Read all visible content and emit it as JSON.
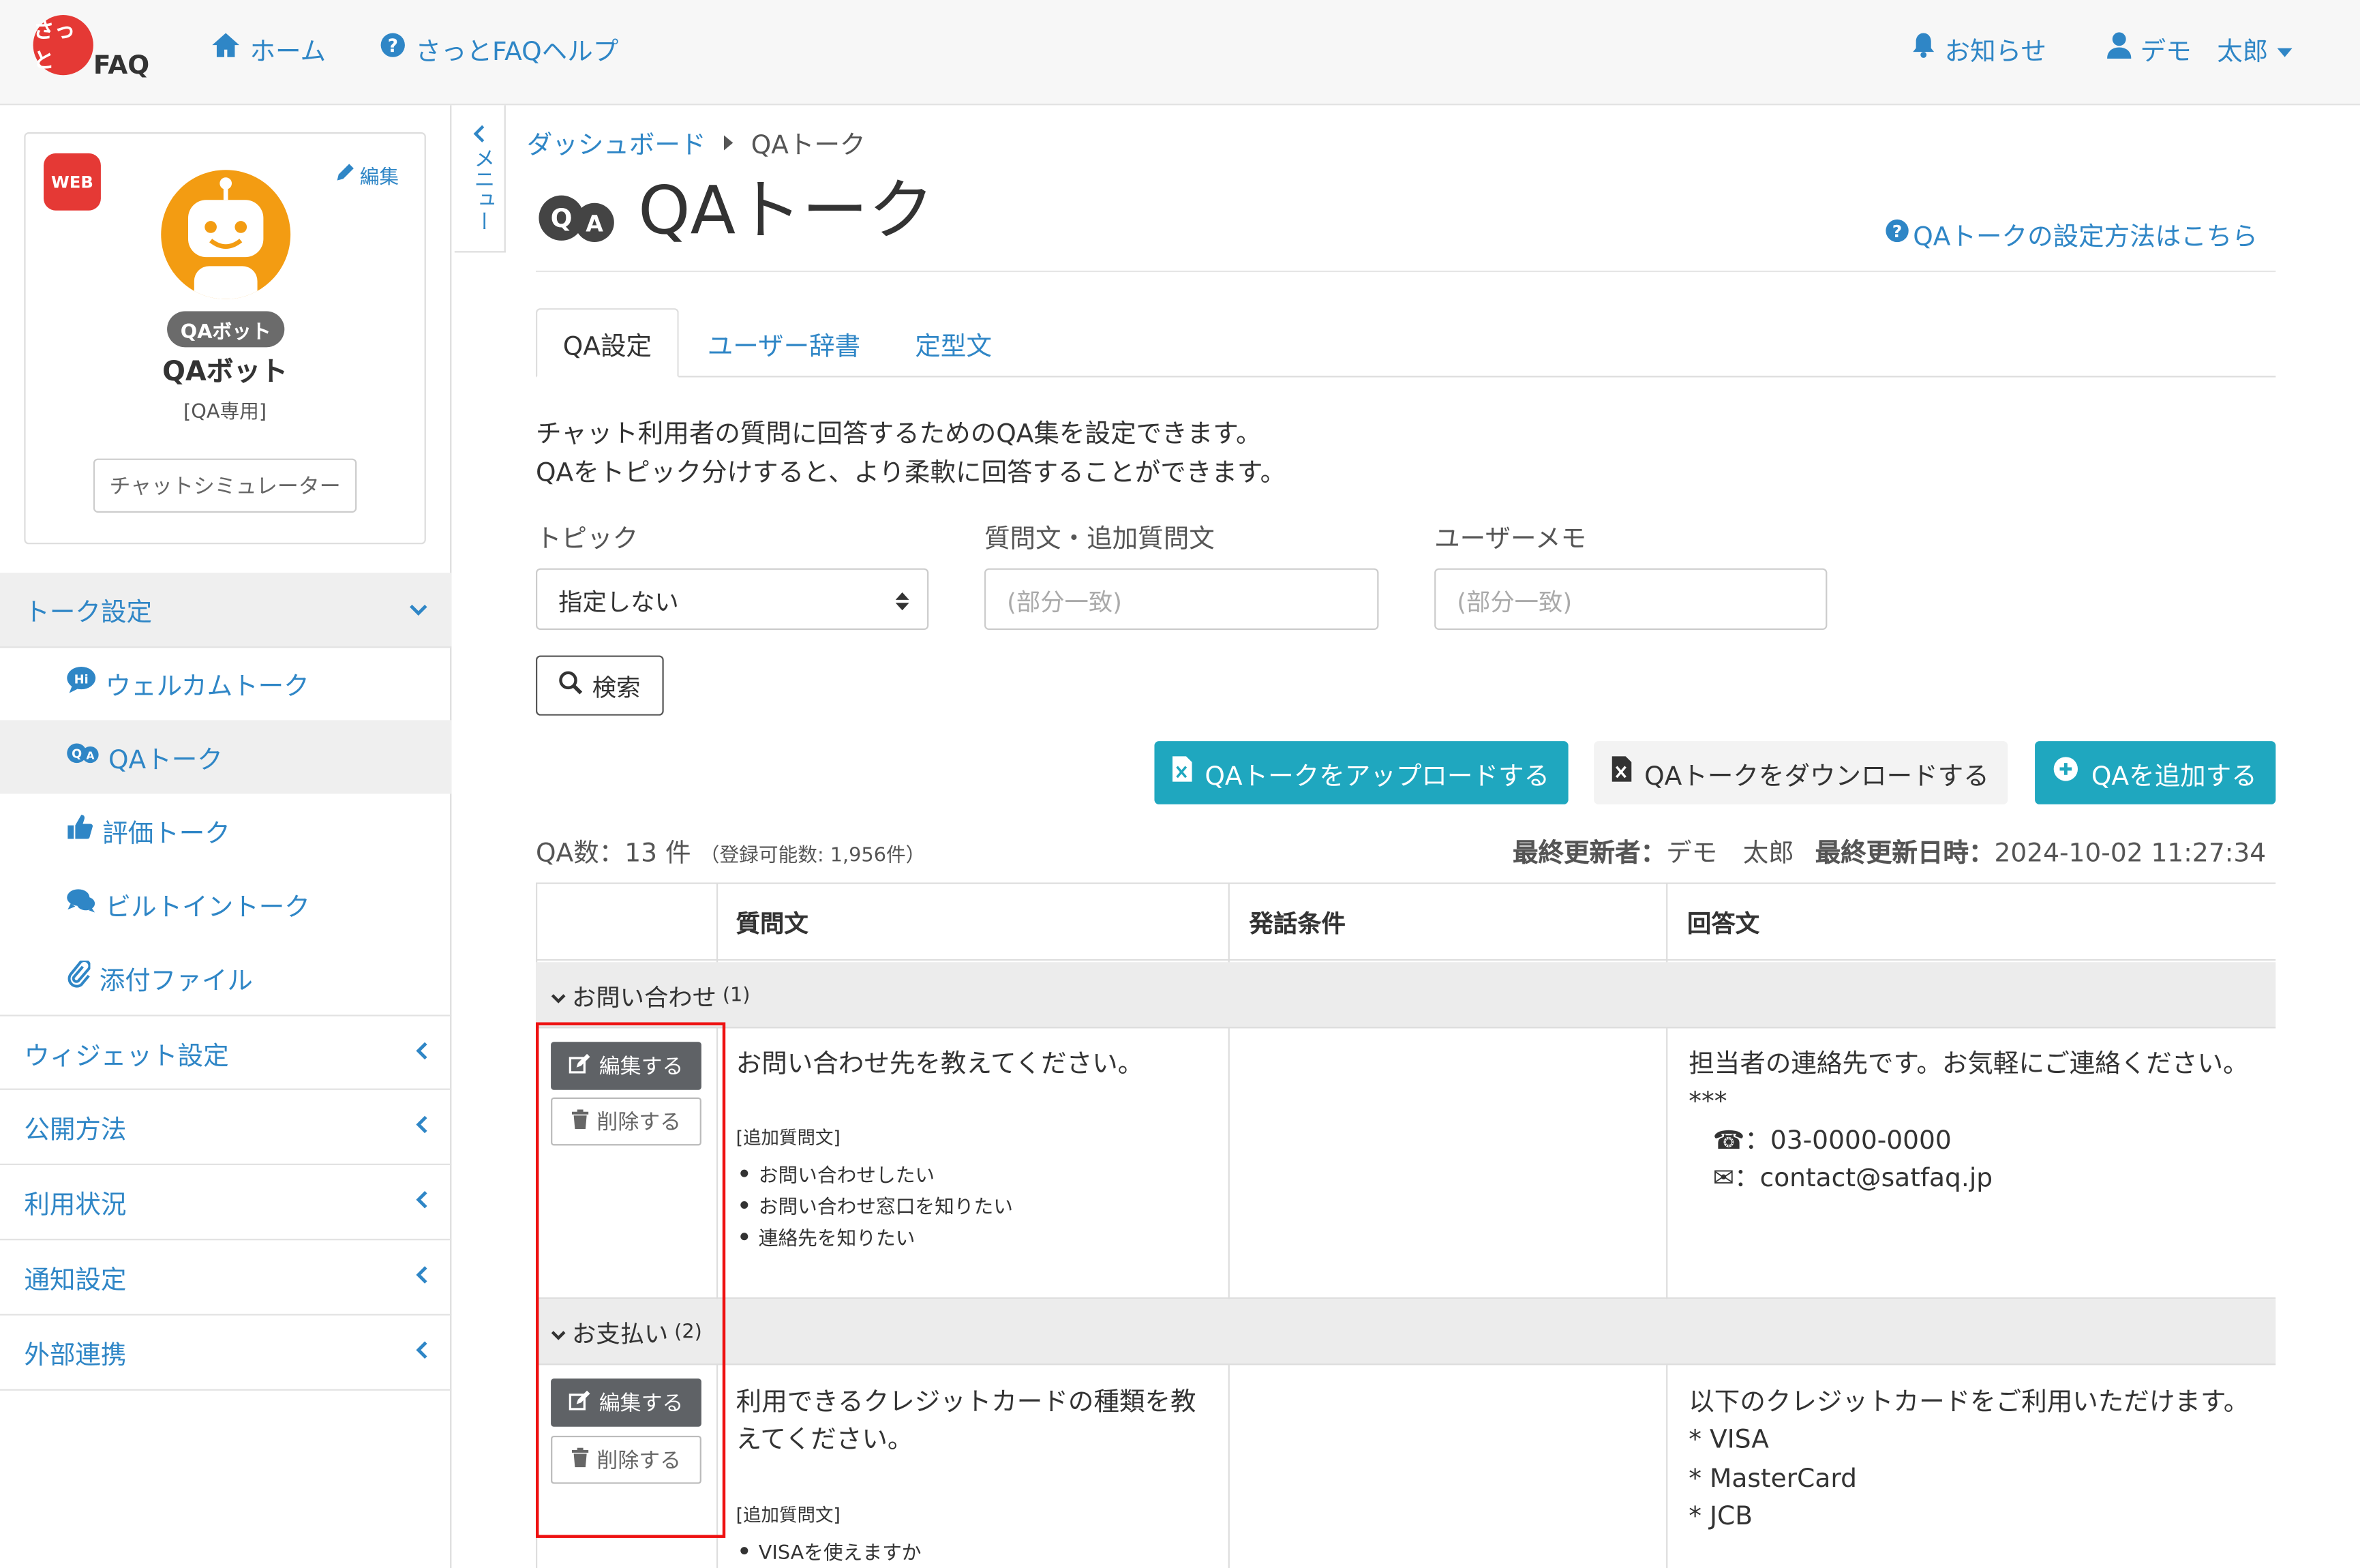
{
  "header": {
    "logo": {
      "mark": "さっと",
      "text": "FAQ"
    },
    "nav_home": "ホーム",
    "nav_help": "さっとFAQヘルプ",
    "notifications": "お知らせ",
    "user_name": "デモ　太郎"
  },
  "sidebar": {
    "badge": "WEB",
    "edit_label": "編集",
    "bot_tag": "QAボット",
    "bot_name": "QAボット",
    "bot_subtitle": "[QA専用]",
    "simulator_button": "チャットシミュレーター",
    "menu_toggle": "メニュー",
    "talk_settings": "トーク設定",
    "sub_items": [
      "ウェルカムトーク",
      "QAトーク",
      "評価トーク",
      "ビルトイントーク",
      "添付ファイル"
    ],
    "menu_items": [
      "ウィジェット設定",
      "公開方法",
      "利用状況",
      "通知設定",
      "外部連携"
    ]
  },
  "breadcrumb": {
    "parent": "ダッシュボード",
    "current": "QAトーク"
  },
  "page": {
    "title": "QAトーク",
    "help_link": "QAトークの設定方法はこちら",
    "tabs": [
      "QA設定",
      "ユーザー辞書",
      "定型文"
    ],
    "description_1": "チャット利用者の質問に回答するためのQA集を設定できます。",
    "description_2": "QAをトピック分けすると、より柔軟に回答することができます。"
  },
  "filters": {
    "topic_label": "トピック",
    "topic_value": "指定しない",
    "question_label": "質問文・追加質問文",
    "question_placeholder": "(部分一致)",
    "memo_label": "ユーザーメモ",
    "memo_placeholder": "(部分一致)",
    "search_button": "検索"
  },
  "actions": {
    "upload": "QAトークをアップロードする",
    "download": "QAトークをダウンロードする",
    "add": "QAを追加する"
  },
  "summary": {
    "count": "QA数：13 件",
    "capacity": "（登録可能数: 1,956件）",
    "updater_label": "最終更新者：",
    "updater": "デモ　太郎",
    "updated_label": "最終更新日時：",
    "updated": "2024-10-02 11:27:34"
  },
  "table": {
    "headers": [
      "質問文",
      "発話条件",
      "回答文"
    ],
    "edit_label": "編集する",
    "delete_label": "削除する",
    "additional_label": "[追加質問文]",
    "groups": [
      {
        "name": "お問い合わせ",
        "count": "(1)",
        "question": "お問い合わせ先を教えてください。",
        "additional": [
          "お問い合わせしたい",
          "お問い合わせ窓口を知りたい",
          "連絡先を知りたい"
        ],
        "answer": [
          "担当者の連絡先です。お気軽にご連絡ください。",
          "***",
          "☎：03-0000-0000",
          "✉：contact@satfaq.jp"
        ]
      },
      {
        "name": "お支払い",
        "count": "(2)",
        "question_1": "利用できるクレジットカードの種類を教",
        "question_2": "えてください。",
        "additional": [
          "VISAを使えますか"
        ],
        "answer": [
          "以下のクレジットカードをご利用いただけます。",
          "* VISA",
          "* MasterCard",
          "* JCB"
        ]
      }
    ]
  }
}
